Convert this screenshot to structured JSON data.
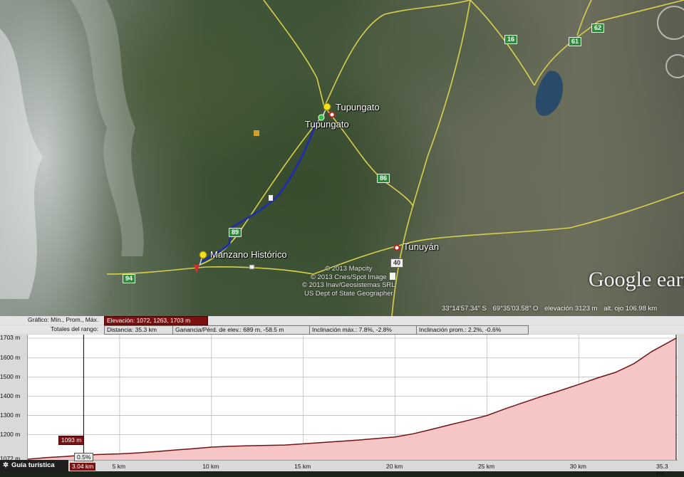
{
  "map": {
    "places": {
      "tupungato_pin": "Tupungato",
      "tupungato_town": "Tupungato",
      "manzano": "Manzano Histórico",
      "tunuyan": "Tunuyán"
    },
    "route_shields": [
      "16",
      "61",
      "62",
      "86",
      "89",
      "40",
      "94"
    ],
    "copyright": [
      "© 2013 Mapcity",
      "© 2013 Cnes/Spot Image",
      "© 2013 Inav/Geosistemas SRL",
      "US Dept of State Geographer"
    ],
    "logo": "Google earth",
    "status": {
      "lat": "33°14'57.34\" S",
      "lon": "69°35'03.58\" O",
      "elev": "elevación  3123 m",
      "eye": "alt. ojo 106.98 km"
    },
    "icons": [
      "pushpin-icon",
      "compass-icon",
      "look-joystick-icon"
    ]
  },
  "profile": {
    "stats_row1": {
      "graph_label": "Gráfico: Mín., Prom., Máx.",
      "elevation": "Elevación: 1072, 1263, 1703 m"
    },
    "stats_row2": {
      "range_label": "Totales del rango:",
      "distance": "Distancia: 35.3 km",
      "gain_loss": "Ganancia/Pérd. de elev.: 689 m, -58.5 m",
      "max_slope": "Inclinación máx.: 7.8%, -2.8%",
      "avg_slope": "Inclinación prom.: 2.2%, -0.6%"
    },
    "cursor": {
      "elevation": "1093 m",
      "slope": "0.5%",
      "distance": "3.04 km"
    },
    "guide_label": "Guía turística"
  },
  "chart_data": {
    "type": "area",
    "xlabel": "",
    "ylabel": "",
    "xlim": [
      0,
      35.3
    ],
    "ylim": [
      1072,
      1703
    ],
    "x_ticks": [
      "5 km",
      "10 km",
      "15 km",
      "20 km",
      "25 km",
      "30 km",
      "35.3 km"
    ],
    "y_ticks": [
      "1703 m",
      "1600 m",
      "1500 m",
      "1400 m",
      "1300 m",
      "1200 m",
      "1072 m"
    ],
    "x_tick_values": [
      5,
      10,
      15,
      20,
      25,
      30,
      35.3
    ],
    "y_tick_values": [
      1703,
      1600,
      1500,
      1400,
      1300,
      1200,
      1072
    ],
    "series": [
      {
        "x": [
          0,
          1,
          2,
          3.04,
          4,
          5,
          6,
          7,
          8,
          9,
          10,
          11,
          12,
          13,
          14,
          15,
          16,
          17,
          18,
          19,
          20,
          21,
          22,
          23,
          24,
          25,
          26,
          27,
          28,
          29,
          30,
          31,
          32,
          33,
          34,
          35.3
        ],
        "y": [
          1072,
          1080,
          1086,
          1093,
          1097,
          1100,
          1105,
          1112,
          1120,
          1127,
          1135,
          1139,
          1142,
          1144,
          1146,
          1152,
          1159,
          1165,
          1172,
          1180,
          1188,
          1205,
          1228,
          1252,
          1275,
          1300,
          1335,
          1368,
          1400,
          1430,
          1462,
          1495,
          1525,
          1570,
          1635,
          1703
        ]
      }
    ],
    "grid": true,
    "fill_color": "#f6c6c6",
    "line_color": "#6e1414"
  }
}
